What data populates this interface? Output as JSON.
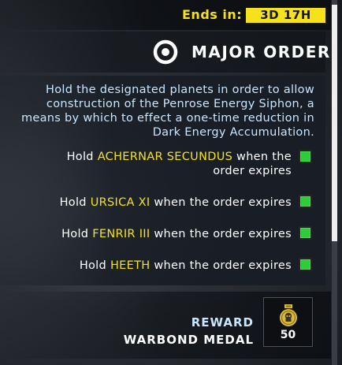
{
  "timer": {
    "label": "Ends in:",
    "value": "3D 17H"
  },
  "header": {
    "icon": "target-icon",
    "title": "MAJOR ORDER"
  },
  "description": "Hold the designated planets in order to allow construction of the Penrose Energy Siphon, a means by which to effect a one-time reduction in Dark Energy Accumulation.",
  "tasks": [
    {
      "prefix": "Hold ",
      "planet": "ACHERNAR SECUNDUS",
      "suffix": " when the order expires",
      "complete": true
    },
    {
      "prefix": "Hold ",
      "planet": "URSICA XI",
      "suffix": " when the order expires",
      "complete": true
    },
    {
      "prefix": "Hold ",
      "planet": "FENRIR III",
      "suffix": " when the order expires",
      "complete": true
    },
    {
      "prefix": "Hold ",
      "planet": "HEETH",
      "suffix": " when the order expires",
      "complete": true
    }
  ],
  "reward": {
    "label": "REWARD",
    "name": "WARBOND MEDAL",
    "icon": "medal-icon",
    "amount": "50"
  },
  "colors": {
    "accent": "#f5e21a",
    "description_text": "#c9e6ff",
    "check_complete": "#2ecc3a"
  }
}
